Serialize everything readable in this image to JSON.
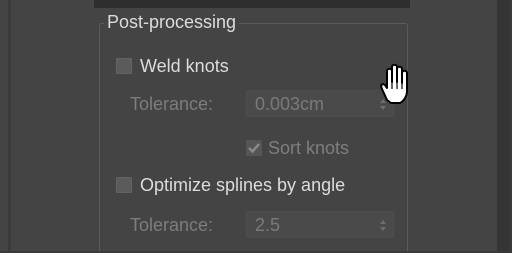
{
  "group": {
    "title": "Post-processing"
  },
  "weld_knots": {
    "label": "Weld knots",
    "checked": false
  },
  "weld_tolerance": {
    "label": "Tolerance:",
    "value": "0.003cm",
    "enabled": false
  },
  "sort_knots": {
    "label": "Sort knots",
    "checked": true,
    "enabled": false
  },
  "optimize_splines": {
    "label": "Optimize splines by angle",
    "checked": false
  },
  "angle_tolerance": {
    "label": "Tolerance:",
    "value": "2.5",
    "enabled": false
  },
  "cursor": {
    "icon": "hand-pointer-icon"
  },
  "colors": {
    "panel_bg": "#444444",
    "text": "#dcdcdc",
    "disabled_text": "#7d7d7d"
  }
}
